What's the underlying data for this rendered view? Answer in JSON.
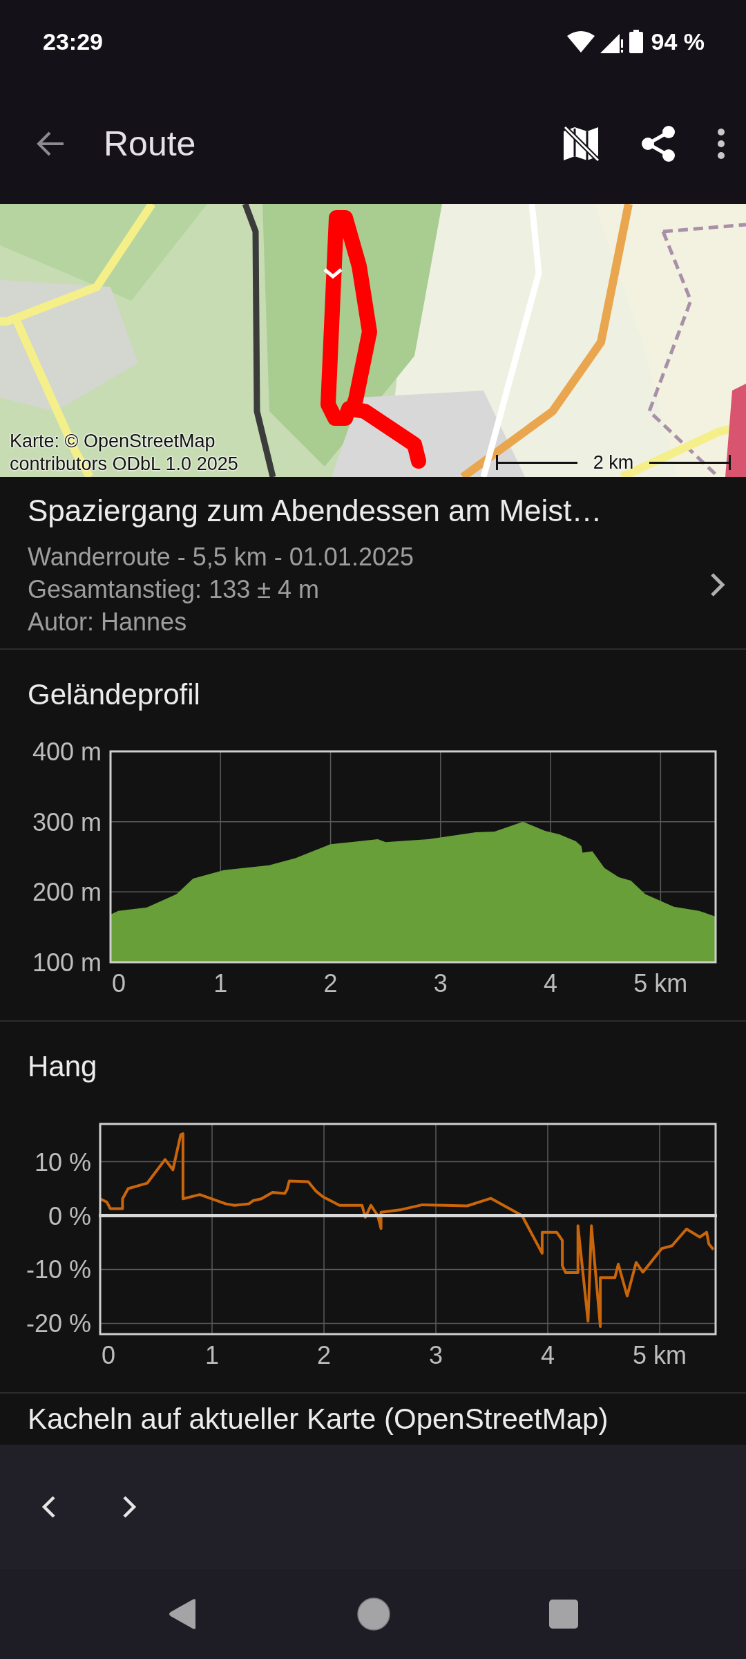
{
  "status_bar": {
    "time": "23:29",
    "battery": "94 %"
  },
  "app_bar": {
    "title": "Route"
  },
  "map": {
    "kind": "picture",
    "attribution_lines": [
      "Karte: © OpenStreetMap",
      "contributors ODbL 1.0 2025"
    ],
    "scale": "2 km"
  },
  "route": {
    "title": "Spaziergang zum Abendessen am Meist…",
    "summary": "Wanderroute - 5,5 km - 01.01.2025",
    "ascent": "Gesamtanstieg: 133 ± 4 m",
    "author": "Autor: Hannes"
  },
  "sections": [
    {
      "title": "Geländeprofil",
      "chart_data": {
        "type": "area",
        "grid": true,
        "xlim": [
          0,
          5.5
        ],
        "ylim": [
          100,
          400
        ],
        "x": [
          0,
          0.07,
          0.33,
          0.6,
          0.75,
          1.03,
          1.44,
          1.68,
          2.0,
          2.43,
          2.5,
          2.89,
          3.32,
          3.49,
          3.75,
          3.95,
          4.08,
          4.23,
          4.28,
          4.29,
          4.38,
          4.49,
          4.62,
          4.73,
          4.86,
          5.12,
          5.35,
          5.5
        ],
        "series": [
          {
            "color": "#689f38",
            "values": [
              168,
              173,
              178,
              197,
              219,
              231,
              238,
              248,
              268,
              275,
              271,
              275,
              285,
              286,
              300,
              287,
              282,
              272,
              265,
              256,
              258,
              234,
              221,
              216,
              197,
              179,
              173,
              165
            ]
          }
        ],
        "xticks": [
          {
            "value": 0,
            "label": "0"
          },
          {
            "value": 1,
            "label": "1"
          },
          {
            "value": 2,
            "label": "2"
          },
          {
            "value": 3,
            "label": "3"
          },
          {
            "value": 4,
            "label": "4"
          },
          {
            "value": 5,
            "label": "5 km"
          }
        ],
        "yticks": [
          {
            "value": 100,
            "label": "100 m"
          },
          {
            "value": 200,
            "label": "200 m"
          },
          {
            "value": 300,
            "label": "300 m"
          },
          {
            "value": 400,
            "label": "400 m"
          }
        ]
      }
    },
    {
      "title": "Hang",
      "chart_data": {
        "type": "line",
        "grid": true,
        "xlim": [
          0,
          5.5
        ],
        "ylim": [
          -22,
          17
        ],
        "x": [
          0,
          0.06,
          0.09,
          0.2,
          0.2,
          0.25,
          0.42,
          0.58,
          0.65,
          0.72,
          0.74,
          0.74,
          0.89,
          1.12,
          1.2,
          1.33,
          1.37,
          1.44,
          1.54,
          1.65,
          1.67,
          1.69,
          1.86,
          1.93,
          1.99,
          2.14,
          2.34,
          2.37,
          2.42,
          2.48,
          2.51,
          2.51,
          2.69,
          2.88,
          3.28,
          3.49,
          3.77,
          3.95,
          3.95,
          4.08,
          4.13,
          4.13,
          4.16,
          4.27,
          4.27,
          4.36,
          4.39,
          4.47,
          4.47,
          4.6,
          4.63,
          4.71,
          4.79,
          4.85,
          5.02,
          5.11,
          5.24,
          5.36,
          5.42,
          5.44,
          5.48
        ],
        "series": [
          {
            "color": "#c9650a",
            "values": [
              3.1,
              2.5,
              1.3,
              1.3,
              3.1,
              5,
              6,
              10.4,
              8.5,
              15,
              15.2,
              3.1,
              3.9,
              2.2,
              1.9,
              2.2,
              2.8,
              3.1,
              4.3,
              4.1,
              4.8,
              6.4,
              6.3,
              4.5,
              3.5,
              1.9,
              1.9,
              -0.3,
              1.9,
              0,
              -2.4,
              0.6,
              1.1,
              2,
              1.8,
              3.2,
              0,
              -7,
              -3.1,
              -3.1,
              -4.6,
              -9.3,
              -10.6,
              -10.6,
              -1.9,
              -19.6,
              -1.9,
              -20.6,
              -11.5,
              -11.5,
              -9,
              -14.9,
              -8.7,
              -10.5,
              -6.1,
              -5.6,
              -2.5,
              -4,
              -3.1,
              -5.3,
              -6.3
            ]
          }
        ],
        "xticks": [
          {
            "value": 0,
            "label": "0"
          },
          {
            "value": 1,
            "label": "1"
          },
          {
            "value": 2,
            "label": "2"
          },
          {
            "value": 3,
            "label": "3"
          },
          {
            "value": 4,
            "label": "4"
          },
          {
            "value": 5,
            "label": "5 km"
          }
        ],
        "yticks": [
          {
            "value": -20,
            "label": "-20 %"
          },
          {
            "value": -10,
            "label": "-10 %"
          },
          {
            "value": 0,
            "label": "0 %"
          },
          {
            "value": 10,
            "label": "10 %"
          }
        ]
      }
    },
    {
      "title": "Kacheln auf aktueller Karte (OpenStreetMap)"
    }
  ]
}
